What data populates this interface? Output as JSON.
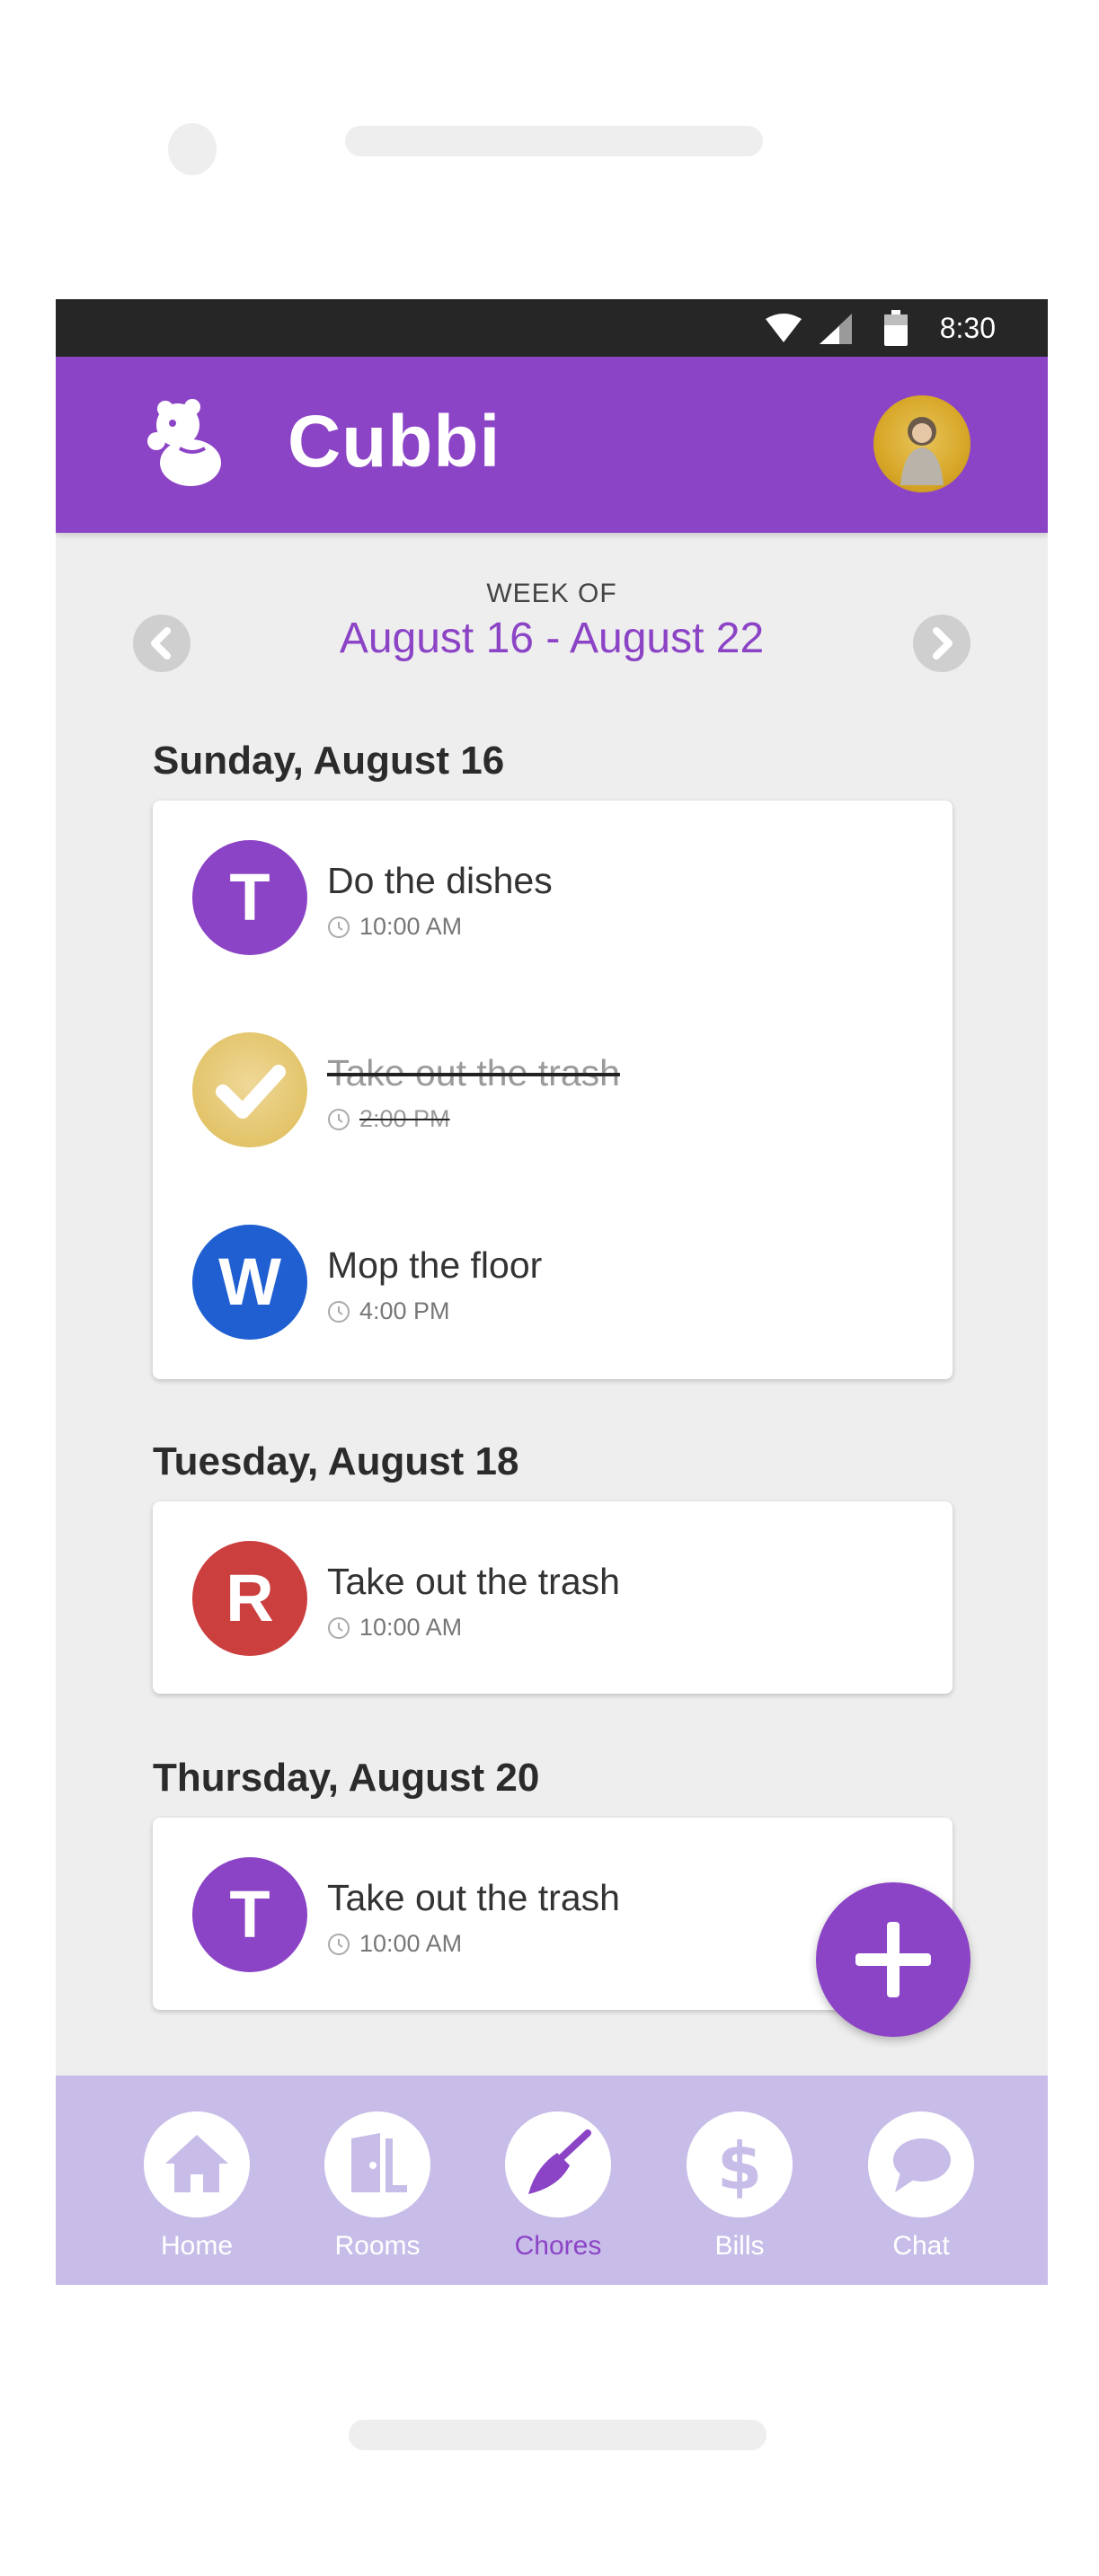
{
  "status_bar": {
    "time": "8:30",
    "wifi_icon": "wifi-icon",
    "signal_icon": "cell-signal-icon",
    "battery_icon": "battery-icon"
  },
  "app_bar": {
    "logo_text": "Cubbi",
    "logo_icon": "mascot-logo-icon",
    "profile_avatar": "profile-avatar-photo"
  },
  "week": {
    "label": "WEEK OF",
    "range": "August 16 - August 22",
    "prev_icon": "chevron-left-icon",
    "next_icon": "chevron-right-icon"
  },
  "days": [
    {
      "heading": "Sunday, August 16",
      "chores": [
        {
          "initial": "T",
          "title": "Do the dishes",
          "time": "10:00 AM",
          "color": "#8c44c6",
          "done": false
        },
        {
          "initial": "",
          "title": "Take out the trash",
          "time": "2:00 PM",
          "color": "#e3c46a",
          "done": true
        },
        {
          "initial": "W",
          "title": "Mop the floor",
          "time": "4:00 PM",
          "color": "#1f5fd1",
          "done": false
        }
      ]
    },
    {
      "heading": "Tuesday, August 18",
      "chores": [
        {
          "initial": "R",
          "title": "Take out the trash",
          "time": "10:00 AM",
          "color": "#cc3f3f",
          "done": false
        }
      ]
    },
    {
      "heading": "Thursday, August 20",
      "chores": [
        {
          "initial": "T",
          "title": "Take out the trash",
          "time": "10:00 AM",
          "color": "#8c44c6",
          "done": false
        }
      ]
    }
  ],
  "fab": {
    "icon": "plus-icon"
  },
  "bottom_nav": {
    "items": [
      {
        "label": "Home",
        "icon": "home-icon",
        "active": false
      },
      {
        "label": "Rooms",
        "icon": "door-icon",
        "active": false
      },
      {
        "label": "Chores",
        "icon": "broom-icon",
        "active": true
      },
      {
        "label": "Bills",
        "icon": "dollar-icon",
        "active": false
      },
      {
        "label": "Chat",
        "icon": "chat-bubble-icon",
        "active": false
      }
    ]
  },
  "colors": {
    "primary": "#8c44c6",
    "background": "#eeeeee",
    "nav_background": "#c8bde8",
    "status_bar": "#262626"
  }
}
